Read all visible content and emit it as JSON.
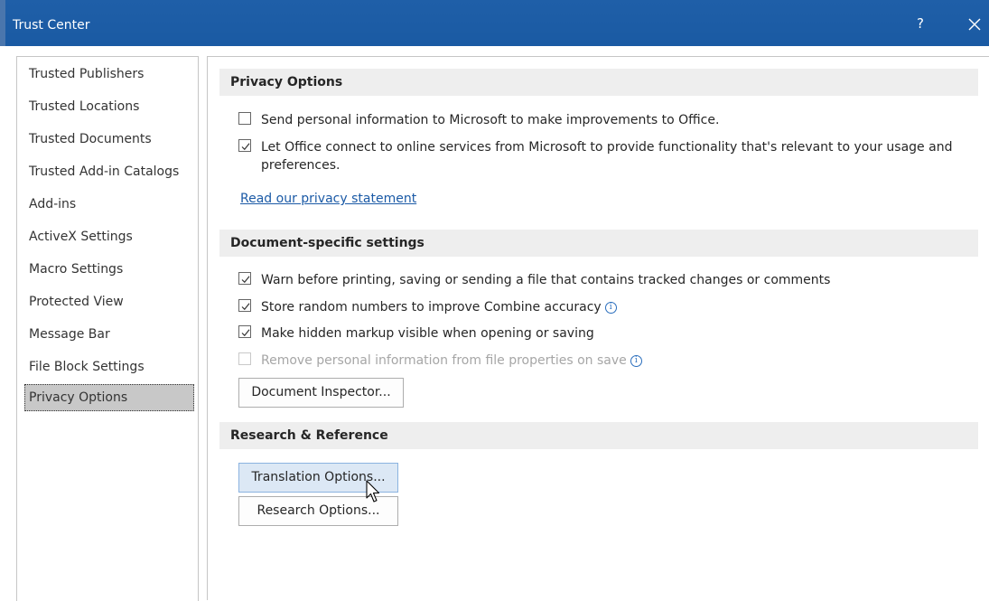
{
  "window": {
    "title": "Trust Center",
    "help_label": "?",
    "close_icon": "close-icon"
  },
  "sidebar": {
    "items": [
      {
        "label": "Trusted Publishers"
      },
      {
        "label": "Trusted Locations"
      },
      {
        "label": "Trusted Documents"
      },
      {
        "label": "Trusted Add-in Catalogs"
      },
      {
        "label": "Add-ins"
      },
      {
        "label": "ActiveX Settings"
      },
      {
        "label": "Macro Settings"
      },
      {
        "label": "Protected View"
      },
      {
        "label": "Message Bar"
      },
      {
        "label": "File Block Settings"
      },
      {
        "label": "Privacy Options",
        "selected": true
      }
    ]
  },
  "privacy": {
    "header": "Privacy Options",
    "options": [
      {
        "label": "Send personal information to Microsoft to make improvements to Office.",
        "checked": false
      },
      {
        "label": "Let Office connect to online services from Microsoft to provide functionality that's relevant to your usage and preferences.",
        "checked": true
      }
    ],
    "link": "Read our privacy statement"
  },
  "document": {
    "header": "Document-specific settings",
    "options": [
      {
        "label": "Warn before printing, saving or sending a file that contains tracked changes or comments",
        "checked": true,
        "disabled": false
      },
      {
        "label": "Store random numbers to improve Combine accuracy",
        "checked": true,
        "disabled": false,
        "info": true
      },
      {
        "label": "Make hidden markup visible when opening or saving",
        "checked": true,
        "disabled": false
      },
      {
        "label": "Remove personal information from file properties on save",
        "checked": false,
        "disabled": true,
        "info": true
      }
    ],
    "inspector_button": "Document Inspector..."
  },
  "research": {
    "header": "Research & Reference",
    "translation_button": "Translation Options...",
    "research_button": "Research Options..."
  },
  "info_glyph": "i",
  "colors": {
    "titlebar": "#1a5aa3",
    "link": "#1b5aa6",
    "selected_nav": "#c8c8c8",
    "button_hover": "#dce8f5"
  }
}
